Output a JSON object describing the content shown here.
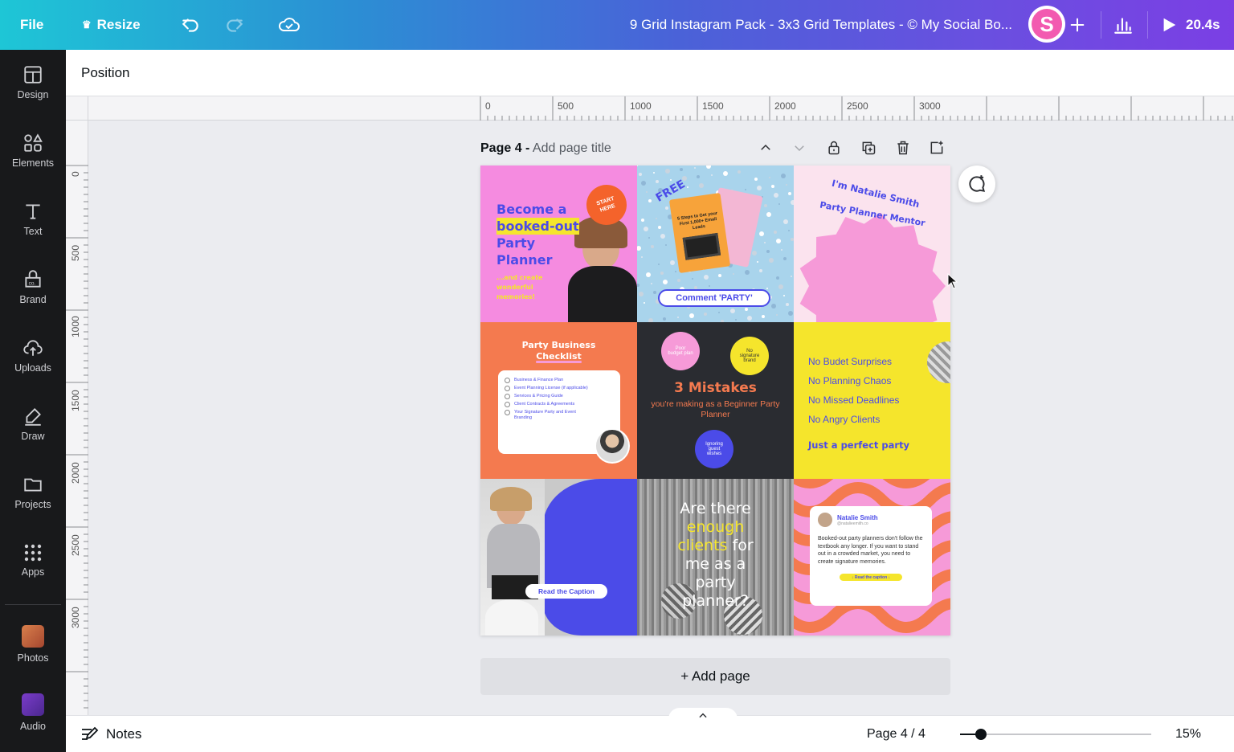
{
  "topbar": {
    "file_label": "File",
    "resize_label": "Resize",
    "document_title": "9 Grid Instagram Pack - 3x3 Grid Templates - © My Social Bo...",
    "avatar_letter": "S",
    "present_timer": "20.4s"
  },
  "sidebar": {
    "items": [
      {
        "label": "Design",
        "icon": "layout-icon"
      },
      {
        "label": "Elements",
        "icon": "shapes-icon"
      },
      {
        "label": "Text",
        "icon": "text-icon"
      },
      {
        "label": "Brand",
        "icon": "brand-icon"
      },
      {
        "label": "Uploads",
        "icon": "cloud-upload-icon"
      },
      {
        "label": "Draw",
        "icon": "pen-icon"
      },
      {
        "label": "Projects",
        "icon": "folder-icon"
      },
      {
        "label": "Apps",
        "icon": "grid-icon"
      },
      {
        "label": "Photos",
        "icon": "photos-app-icon"
      },
      {
        "label": "Audio",
        "icon": "audio-app-icon"
      }
    ]
  },
  "position_bar": {
    "label": "Position"
  },
  "ruler": {
    "top_labels": [
      "0",
      "500",
      "1000",
      "1500",
      "2000",
      "2500",
      "3000"
    ],
    "left_labels": [
      "0",
      "500",
      "1000",
      "1500",
      "2000",
      "2500",
      "3000"
    ]
  },
  "page": {
    "name": "Page 4 -",
    "title_placeholder": "Add page title"
  },
  "tiles": {
    "t1": {
      "headline1": "Become a",
      "headline2": "booked-out",
      "headline3": "Party",
      "headline4": "Planner",
      "sub": "...and create wonderful memories!",
      "badge": "START HERE"
    },
    "t2": {
      "arc": "FREE",
      "card": "5 Steps to Get your First 1,000+ Email Leads",
      "button": "Comment 'PARTY'"
    },
    "t3": {
      "arc1": "I'm Natalie Smith",
      "arc2": "Party Planner Mentor"
    },
    "t4": {
      "title1": "Party Business",
      "title2": "Checklist",
      "items": [
        "Business & Finance Plan",
        "Event Planning License (if applicable)",
        "Services & Pricing Guide",
        "Client Contracts & Agreements",
        "Your Signature Party and Event Branding"
      ]
    },
    "t5": {
      "badge1": "Poor budget plan",
      "badge2": "No signature brand",
      "headline": "3 Mistakes",
      "sub": "you're making as a Beginner Party Planner",
      "badge3": "Ignoring guest wishes"
    },
    "t6": {
      "lines": [
        "No Budet Surprises",
        "No Planning Chaos",
        "No Missed Deadlines",
        "No Angry Clients"
      ],
      "closing": "Just a perfect party"
    },
    "t7": {
      "button": "Read the Caption"
    },
    "t8": {
      "line1": "Are there",
      "line2": "enough",
      "line3": "clients",
      "line4": "for",
      "line5": "me as a",
      "line6": "party",
      "line7": "planner?"
    },
    "t9": {
      "name": "Natalie Smith",
      "handle": "@natalieemith.co",
      "body": "Booked-out party planners don't follow the textbook any longer. If you want to stand out in a crowded market, you need to create signature memories.",
      "button": "↓ Read the caption ↓"
    }
  },
  "add_page_label": "+ Add page",
  "bottombar": {
    "notes_label": "Notes",
    "page_indicator": "Page 4 / 4",
    "zoom": "15%",
    "zoom_fraction": 0.11
  },
  "colors": {
    "accent_pink": "#f58be0",
    "accent_blue": "#4b4be8",
    "accent_yellow": "#f5e52c",
    "accent_orange": "#f47a4f"
  }
}
